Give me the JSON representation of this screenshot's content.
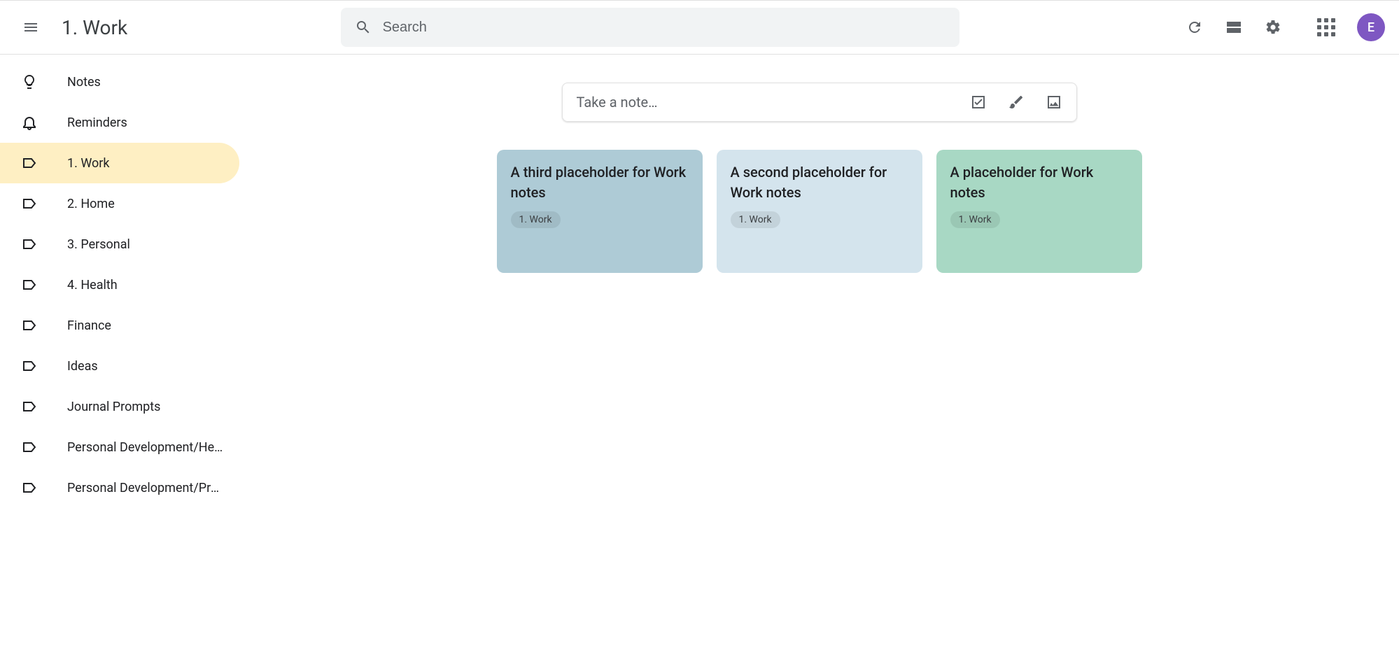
{
  "header": {
    "title": "1. Work",
    "search_placeholder": "Search",
    "avatar_letter": "E"
  },
  "sidebar": {
    "items": [
      {
        "icon": "bulb",
        "label": "Notes"
      },
      {
        "icon": "bell",
        "label": "Reminders"
      },
      {
        "icon": "label",
        "label": "1. Work",
        "active": true
      },
      {
        "icon": "label",
        "label": "2. Home"
      },
      {
        "icon": "label",
        "label": "3. Personal"
      },
      {
        "icon": "label",
        "label": "4. Health"
      },
      {
        "icon": "label",
        "label": "Finance"
      },
      {
        "icon": "label",
        "label": "Ideas"
      },
      {
        "icon": "label",
        "label": "Journal Prompts"
      },
      {
        "icon": "label",
        "label": "Personal Development/Heal…"
      },
      {
        "icon": "label",
        "label": "Personal Development/Proj…"
      }
    ]
  },
  "take_note": {
    "placeholder": "Take a note…"
  },
  "notes": [
    {
      "title": "A third placeholder for Work notes",
      "label": "1. Work",
      "color": "#aecbd6"
    },
    {
      "title": "A second placeholder for Work notes",
      "label": "1. Work",
      "color": "#d4e4ed"
    },
    {
      "title": "A placeholder for Work notes",
      "label": "1. Work",
      "color": "#a8d8c4"
    }
  ]
}
